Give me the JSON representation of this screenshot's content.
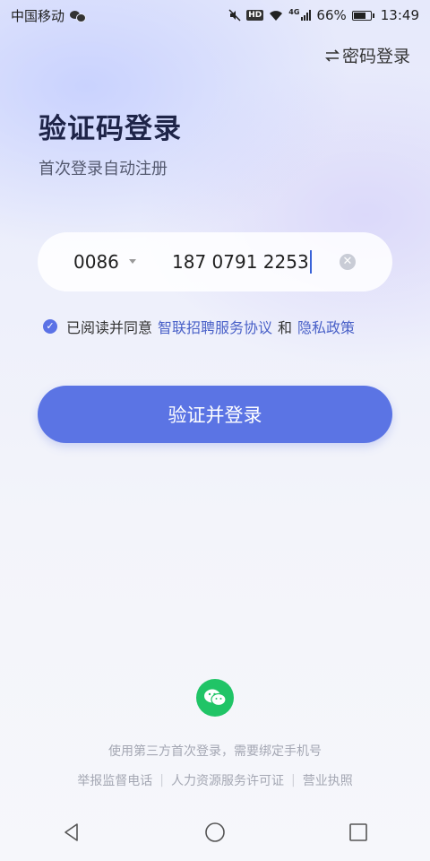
{
  "status_bar": {
    "carrier": "中国移动",
    "network": "4G",
    "hd": "HD",
    "battery": "66%",
    "time": "13:49"
  },
  "header": {
    "switch_icon": "swap-arrows-icon",
    "password_login": "密码登录"
  },
  "title": "验证码登录",
  "subtitle": "首次登录自动注册",
  "phone": {
    "country_code": "0086",
    "number": "187 0791 2253"
  },
  "agreement": {
    "prefix": "已阅读并同意",
    "service_agreement": "智联招聘服务协议",
    "and": "和",
    "privacy_policy": "隐私政策"
  },
  "verify_button": "验证并登录",
  "third_party": {
    "icon": "wechat-icon",
    "note": "使用第三方首次登录，需要绑定手机号"
  },
  "footer": {
    "report_phone": "举报监督电话",
    "hr_license": "人力资源服务许可证",
    "business_license": "营业执照"
  },
  "colors": {
    "primary": "#5b74e4",
    "link": "#4a61c8",
    "wechat": "#20c466",
    "title": "#1e2448"
  }
}
